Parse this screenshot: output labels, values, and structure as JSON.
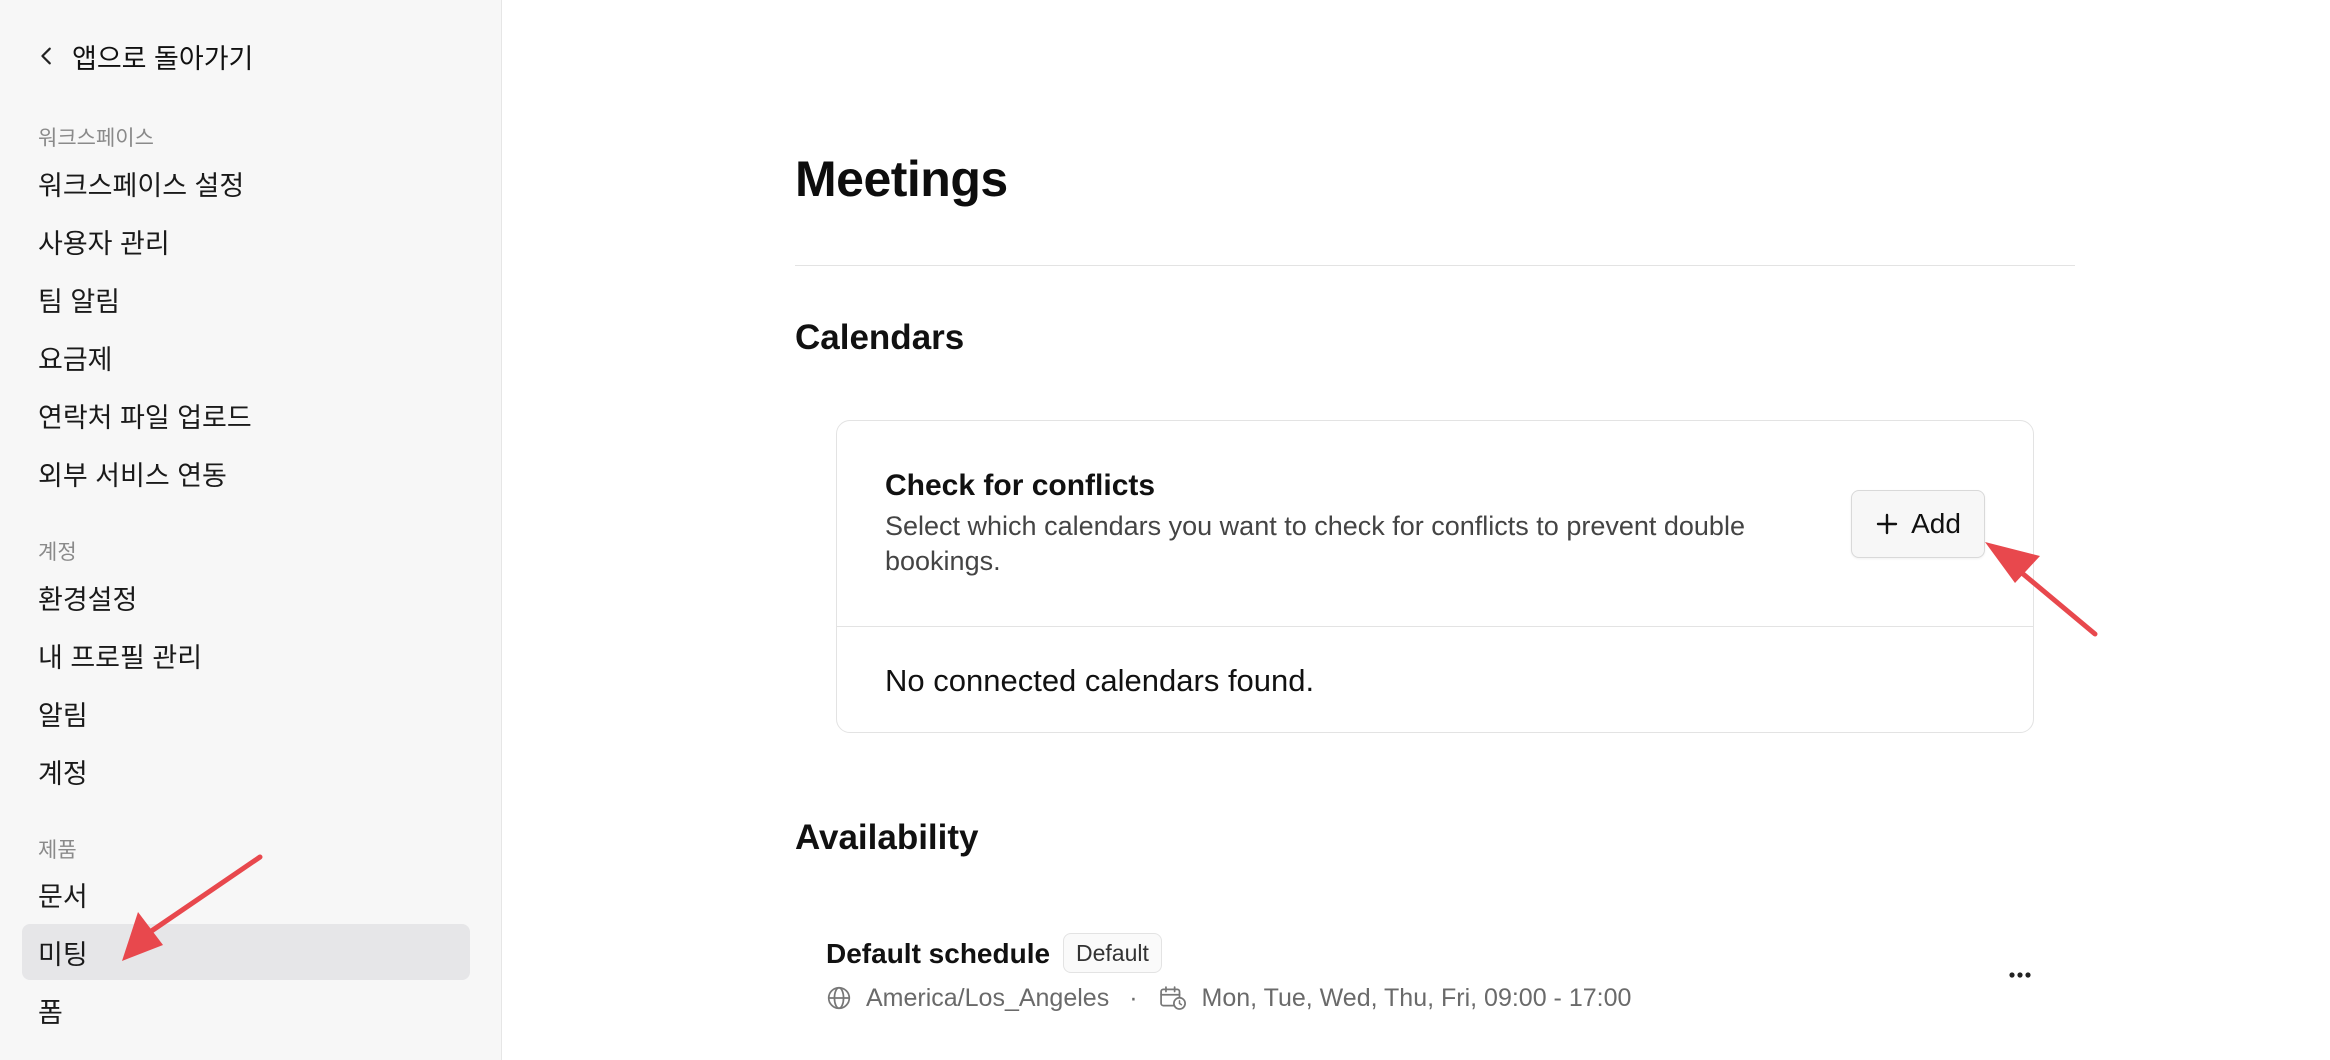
{
  "sidebar": {
    "back_label": "앱으로 돌아가기",
    "sections": [
      {
        "label": "워크스페이스",
        "items": [
          {
            "label": "워크스페이스 설정"
          },
          {
            "label": "사용자 관리"
          },
          {
            "label": "팀 알림"
          },
          {
            "label": "요금제"
          },
          {
            "label": "연락처 파일 업로드"
          },
          {
            "label": "외부 서비스 연동"
          }
        ]
      },
      {
        "label": "계정",
        "items": [
          {
            "label": "환경설정"
          },
          {
            "label": "내 프로필 관리"
          },
          {
            "label": "알림"
          },
          {
            "label": "계정"
          }
        ]
      },
      {
        "label": "제품",
        "items": [
          {
            "label": "문서"
          },
          {
            "label": "미팅",
            "active": true
          },
          {
            "label": "폼"
          }
        ]
      }
    ]
  },
  "main": {
    "title": "Meetings",
    "calendars": {
      "heading": "Calendars",
      "card": {
        "title": "Check for conflicts",
        "description": "Select which calendars you want to check for conflicts to prevent double bookings.",
        "add_label": "Add",
        "empty_text": "No connected calendars found."
      }
    },
    "availability": {
      "heading": "Availability",
      "schedule": {
        "name": "Default schedule",
        "badge": "Default",
        "timezone": "America/Los_Angeles",
        "separator": "·",
        "hours": "Mon, Tue, Wed, Thu, Fri, 09:00 - 17:00",
        "more_label": "..."
      }
    }
  },
  "colors": {
    "sidebar_bg": "#f7f7f7",
    "active_item_bg": "#e6e6e8",
    "annotation_arrow": "#e8484d"
  }
}
